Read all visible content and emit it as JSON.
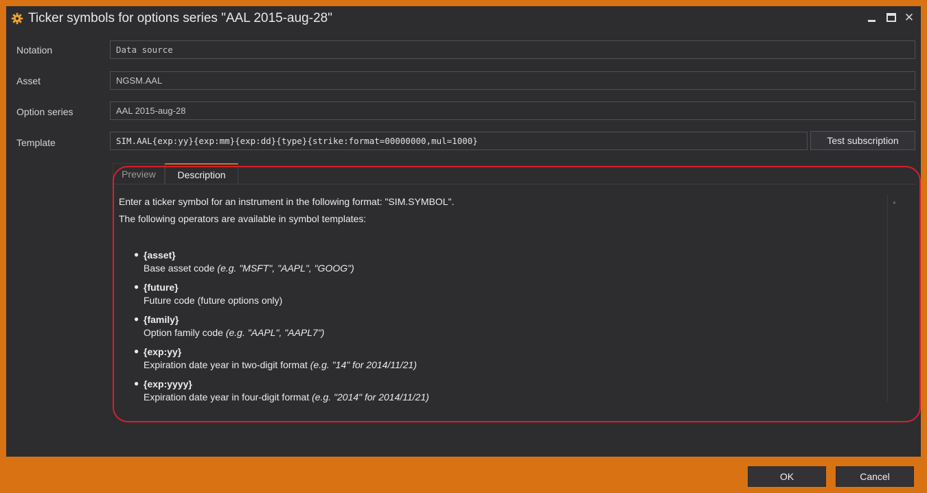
{
  "window": {
    "title": "Ticker symbols for options series \"AAL 2015-aug-28\"",
    "accent_color": "#d97212",
    "icon": "gear-icon"
  },
  "form": {
    "notation_label": "Notation",
    "notation_value": "Data source",
    "asset_label": "Asset",
    "asset_value": "NGSM.AAL",
    "option_series_label": "Option series",
    "option_series_value": "AAL 2015-aug-28",
    "template_label": "Template",
    "template_value": "SIM.AAL{exp:yy}{exp:mm}{exp:dd}{type}{strike:format=00000000,mul=1000}",
    "test_button": "Test subscription"
  },
  "tabs": [
    {
      "label": "Preview",
      "active": false
    },
    {
      "label": "Description",
      "active": true
    }
  ],
  "description": {
    "intro1": "Enter a ticker symbol for an instrument in the following format: \"SIM.SYMBOL\".",
    "intro2": "The following operators are available in symbol templates:",
    "operators": [
      {
        "name": "{asset}",
        "text": "Base asset code ",
        "example": "(e.g. \"MSFT\", \"AAPL\", \"GOOG\")"
      },
      {
        "name": "{future}",
        "text": "Future code (future options only)",
        "example": ""
      },
      {
        "name": "{family}",
        "text": "Option family code ",
        "example": "(e.g. \"AAPL\", \"AAPL7\")"
      },
      {
        "name": "{exp:yy}",
        "text": "Expiration date year in two-digit format ",
        "example": "(e.g. \"14\" for 2014/11/21)"
      },
      {
        "name": "{exp:yyyy}",
        "text": "Expiration date year in four-digit format ",
        "example": "(e.g. \"2014\" for 2014/11/21)"
      }
    ]
  },
  "footer": {
    "ok": "OK",
    "cancel": "Cancel"
  }
}
